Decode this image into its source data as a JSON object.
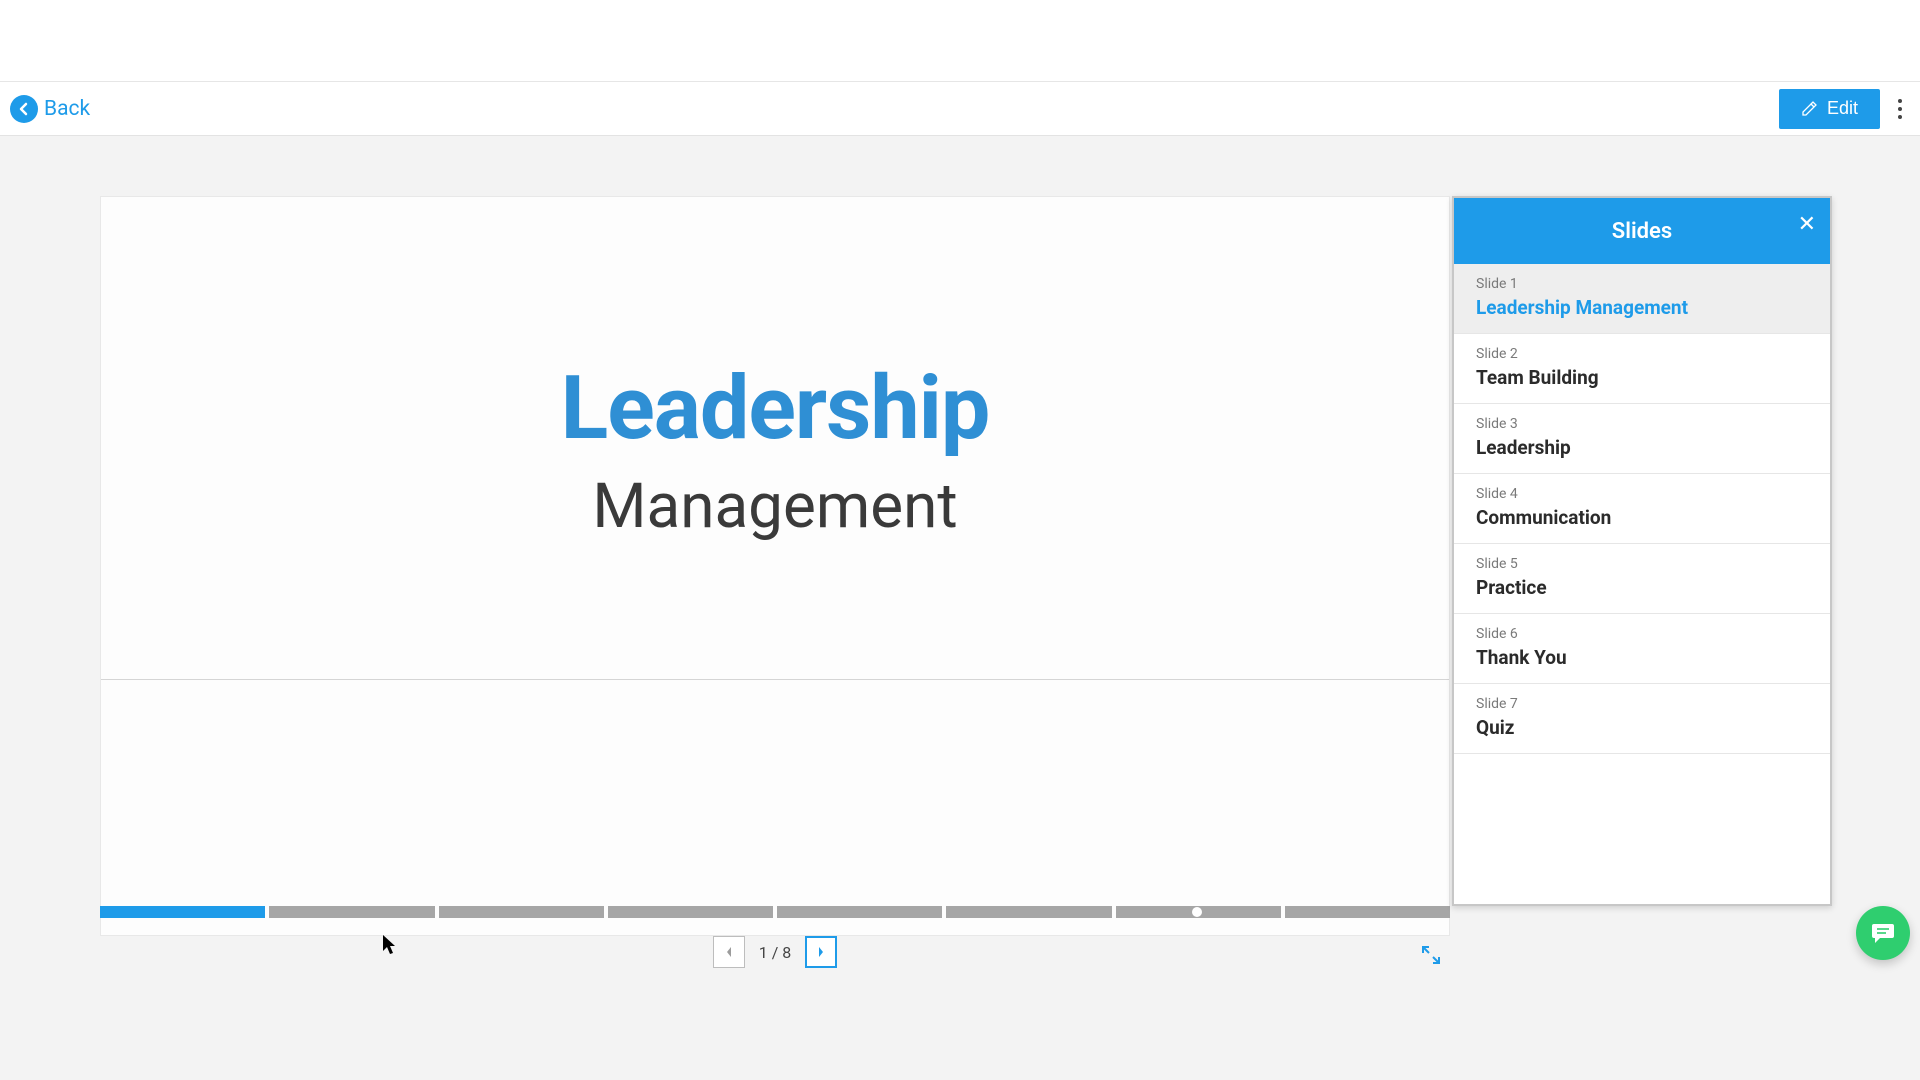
{
  "toolbar": {
    "back_label": "Back",
    "edit_label": "Edit"
  },
  "slide": {
    "title": "Leadership",
    "subtitle": "Management"
  },
  "pager": {
    "current": "1",
    "total": "8",
    "separator": " / "
  },
  "panel": {
    "title": "Slides",
    "items": [
      {
        "num": "Slide 1",
        "name": "Leadership Management",
        "selected": true
      },
      {
        "num": "Slide 2",
        "name": "Team Building",
        "selected": false
      },
      {
        "num": "Slide 3",
        "name": "Leadership",
        "selected": false
      },
      {
        "num": "Slide 4",
        "name": "Communication",
        "selected": false
      },
      {
        "num": "Slide 5",
        "name": "Practice",
        "selected": false
      },
      {
        "num": "Slide 6",
        "name": "Thank You",
        "selected": false
      },
      {
        "num": "Slide 7",
        "name": "Quiz",
        "selected": false
      }
    ]
  },
  "progress": {
    "segments": 8,
    "active_index": 0,
    "dot_segment": 6
  },
  "colors": {
    "accent": "#1e9be9",
    "chat": "#2fce6f"
  }
}
